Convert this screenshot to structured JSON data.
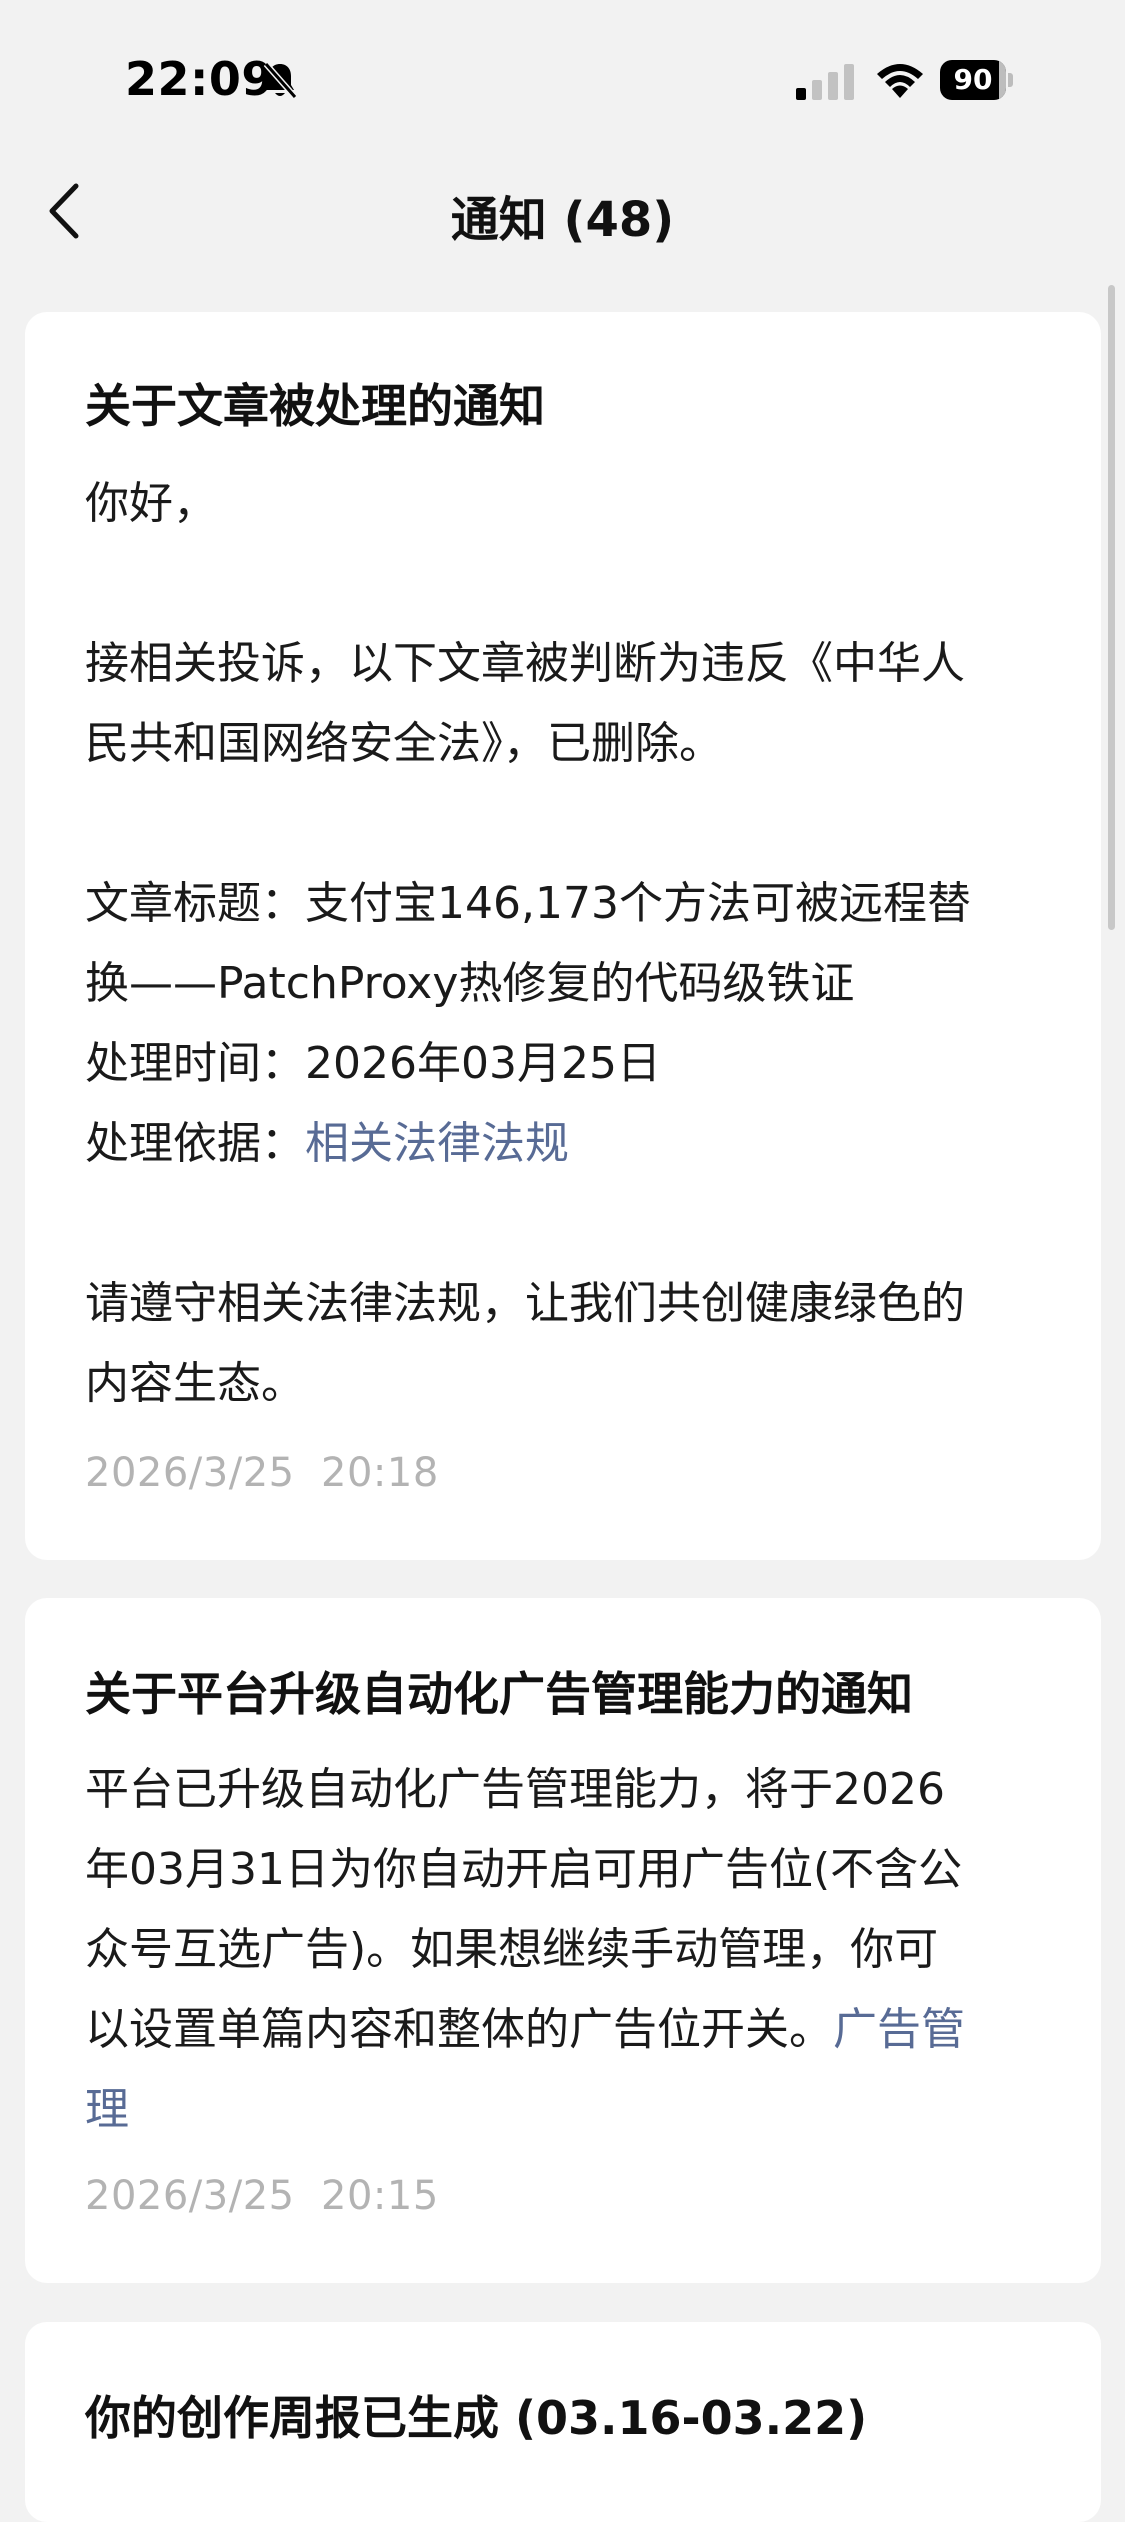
{
  "status_bar": {
    "time": "22:09",
    "battery": "90",
    "battery_level": 0.9,
    "icons": [
      "bell-slash-icon",
      "cellular-signal-icon",
      "wifi-icon",
      "battery-icon"
    ]
  },
  "nav": {
    "back_icon": "chevron-left-icon",
    "title": "通知 (48)"
  },
  "notices": [
    {
      "title": "关于文章被处理的通知",
      "greeting": "你好，",
      "line1": "接相关投诉，以下文章被判断为违反《中华人",
      "line2": "民共和国网络安全法》，已删除。",
      "article_label": "文章标题：",
      "article_title_part1": "支付宝146,173个方法可被远程替",
      "article_title_part2": "换——PatchProxy热修复的代码级铁证",
      "time_label": "处理时间：",
      "time_value": "2026年03月25日",
      "basis_label": "处理依据：",
      "basis_link": "相关法律法规",
      "closing1": "请遵守相关法律法规，让我们共创健康绿色的",
      "closing2": "内容生态。",
      "timestamp": "2026/3/25  20:18"
    },
    {
      "title": "关于平台升级自动化广告管理能力的通知",
      "body1": "平台已升级自动化广告管理能力，将于2026",
      "body2": "年03月31日为你自动开启可用广告位(不含公",
      "body3": "众号互选广告)。如果想继续手动管理，你可",
      "body4": "以设置单篇内容和整体的广告位开关。",
      "link_part1": "广告管",
      "link_part2": "理",
      "timestamp": "2026/3/25  20:15"
    },
    {
      "title": "你的创作周报已生成 (03.16-03.22)"
    }
  ],
  "colors": {
    "background": "#f2f2f2",
    "card": "#ffffff",
    "link": "#586b95",
    "timestamp": "#b3b3b3"
  }
}
